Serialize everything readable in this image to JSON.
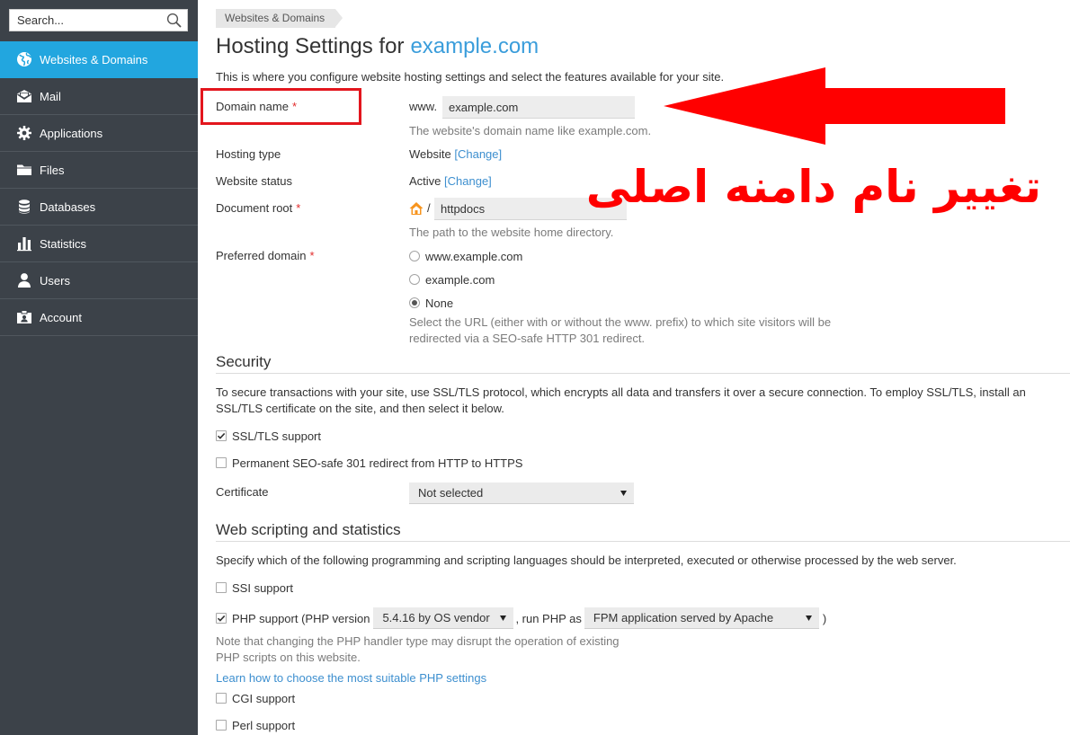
{
  "colors": {
    "sidebar_bg": "#3c4249",
    "accent": "#22a6df",
    "link": "#3d8fcf",
    "title_domain": "#3a9ddb",
    "required": "#e22b2b",
    "annotation": "#ff0000",
    "annotation_box": "#e3161d"
  },
  "sidebar": {
    "search": {
      "placeholder": "Search...",
      "icon": "search-icon"
    },
    "items": [
      {
        "label": "Websites & Domains",
        "icon": "globe-icon",
        "active": true
      },
      {
        "label": "Mail",
        "icon": "mail-icon",
        "active": false
      },
      {
        "label": "Applications",
        "icon": "gear-icon",
        "active": false
      },
      {
        "label": "Files",
        "icon": "folder-icon",
        "active": false
      },
      {
        "label": "Databases",
        "icon": "database-icon",
        "active": false
      },
      {
        "label": "Statistics",
        "icon": "bar-chart-icon",
        "active": false
      },
      {
        "label": "Users",
        "icon": "user-icon",
        "active": false
      },
      {
        "label": "Account",
        "icon": "account-icon",
        "active": false
      }
    ]
  },
  "breadcrumb": {
    "items": [
      "Websites & Domains"
    ]
  },
  "header": {
    "title_prefix": "Hosting Settings for",
    "title_domain": "example.com",
    "description": "This is where you configure website hosting settings and select the features available for your site."
  },
  "hosting": {
    "domain_name": {
      "label": "Domain name",
      "required_mark": "*",
      "prefix": "www.",
      "value": "example.com",
      "help": "The website's domain name like example.com."
    },
    "hosting_type": {
      "label": "Hosting type",
      "value": "Website",
      "change_link": "[Change]"
    },
    "website_status": {
      "label": "Website status",
      "value": "Active",
      "change_link": "[Change]"
    },
    "document_root": {
      "label": "Document root",
      "required_mark": "*",
      "icon": "home-icon",
      "separator": "/",
      "value": "httpdocs",
      "help": "The path to the website home directory."
    },
    "preferred_domain": {
      "label": "Preferred domain",
      "required_mark": "*",
      "options": [
        {
          "label": "www.example.com",
          "checked": false
        },
        {
          "label": "example.com",
          "checked": false
        },
        {
          "label": "None",
          "checked": true
        }
      ],
      "help_lines": [
        "Select the URL (either with or without the www. prefix) to which site visitors will be",
        "redirected via a SEO-safe HTTP 301 redirect."
      ]
    }
  },
  "security": {
    "heading": "Security",
    "intro_lines": [
      "To secure transactions with your site, use SSL/TLS protocol, which encrypts all data and transfers it over a secure connection. To employ SSL/TLS, install an",
      "SSL/TLS certificate on the site, and then select it below."
    ],
    "ssl_support": {
      "label": "SSL/TLS support",
      "checked": true
    },
    "https_redirect": {
      "label": "Permanent SEO-safe 301 redirect from HTTP to HTTPS",
      "checked": false
    },
    "certificate": {
      "label": "Certificate",
      "value": "Not selected"
    }
  },
  "scripting": {
    "heading": "Web scripting and statistics",
    "intro": "Specify which of the following programming and scripting languages should be interpreted, executed or otherwise processed by the web server.",
    "ssi": {
      "label": "SSI support",
      "checked": false
    },
    "php": {
      "checked": true,
      "label": "PHP support (PHP version",
      "version": "5.4.16 by OS vendor",
      "run_as_label": ", run PHP as",
      "handler": "FPM application served by Apache",
      "closing": ")",
      "note_lines": [
        "Note that changing the PHP handler type may disrupt the operation of existing",
        "PHP scripts on this website."
      ],
      "help_link": "Learn how to choose the most suitable PHP settings"
    },
    "cgi": {
      "label": "CGI support",
      "checked": false
    },
    "perl": {
      "label": "Perl support",
      "checked": false
    }
  },
  "annotation": {
    "text": "تغییر نام دامنه اصلی",
    "arrow_icon": "arrow-left-icon"
  }
}
